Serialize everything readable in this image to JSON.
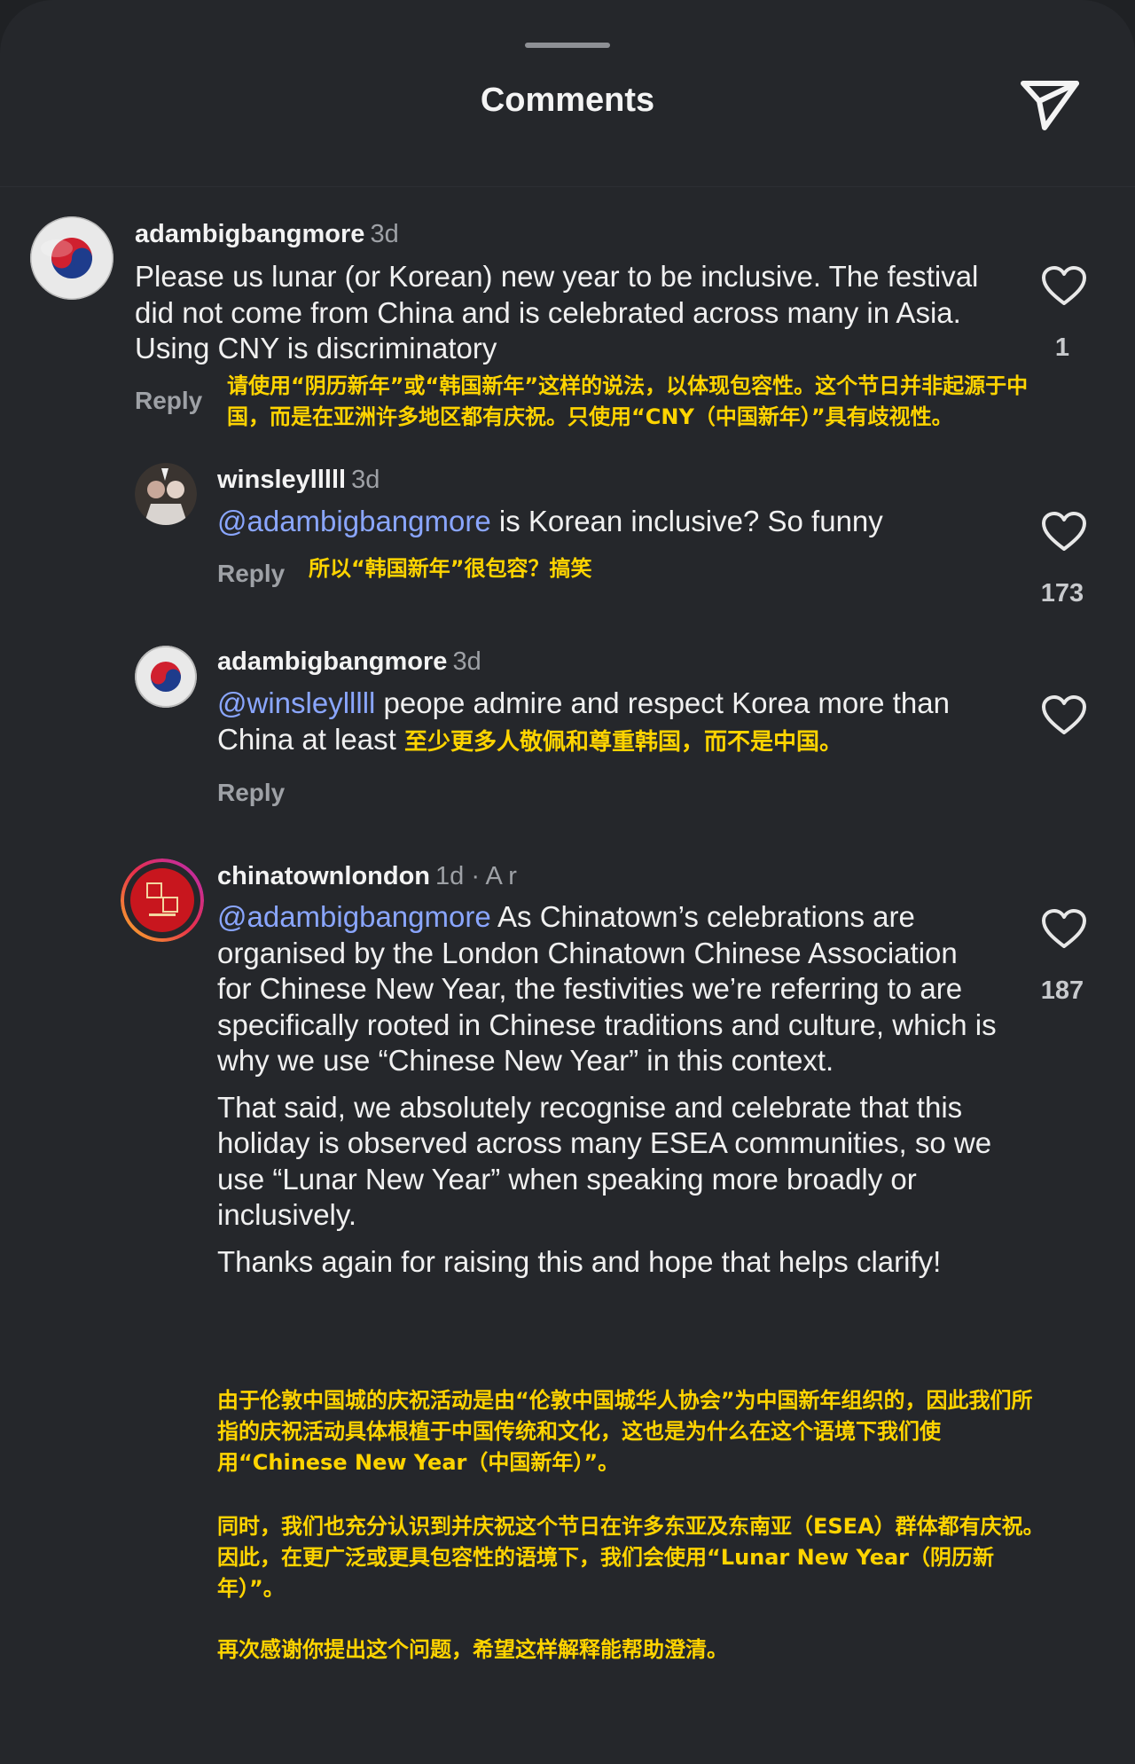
{
  "header": {
    "title": "Comments"
  },
  "comments": [
    {
      "username": "adambigbangmore",
      "time": "3d",
      "text": "Please us lunar (or Korean) new year to be inclusive. The festival did not come from China and is celebrated across many in Asia. Using CNY is discriminatory",
      "reply_label": "Reply",
      "translation": "请使用“阴历新年”或“韩国新年”这样的说法，以体现包容性。这个节日并非起源于中国，而是在亚洲许多地区都有庆祝。只使用“CNY（中国新年）”具有歧视性。",
      "likes": "1"
    },
    {
      "username": "winsleylllll",
      "time": "3d",
      "mention": "@adambigbangmore",
      "text": " is Korean inclusive? So funny",
      "reply_label": "Reply",
      "translation": "所以“韩国新年”很包容？搞笑",
      "likes": "173"
    },
    {
      "username": "adambigbangmore",
      "time": "3d",
      "mention": "@winsleylllll",
      "text": " peope admire and respect Korea more than China at least ",
      "reply_label": "Reply",
      "translation": "至少更多人敬佩和尊重韩国，而不是中国。"
    },
    {
      "username": "chinatownlondon",
      "time": "1d · A    r",
      "mention": "@adambigbangmore",
      "text_p1": " As Chinatown’s celebrations are organised by the London Chinatown Chinese Association for Chinese New Year, the festivities we’re referring to are specifically rooted in Chinese traditions and culture, which is why we use “Chinese New Year” in this context.",
      "text_p2": "That said, we absolutely recognise and celebrate that this holiday is observed across many ESEA communities, so we use “Lunar New Year” when speaking more broadly or inclusively.",
      "text_p3": "Thanks again for raising this and hope that helps clarify!",
      "translation_p1": "由于伦敦中国城的庆祝活动是由“伦敦中国城华人协会”为中国新年组织的，因此我们所指的庆祝活动具体根植于中国传统和文化，这也是为什么在这个语境下我们使用“Chinese New Year（中国新年）”。",
      "translation_p2": "同时，我们也充分认识到并庆祝这个节日在许多东亚及东南亚（ESEA）群体都有庆祝。因此，在更广泛或更具包容性的语境下，我们会使用“Lunar New Year（阴历新年）”。",
      "translation_p3": "再次感谢你提出这个问题，希望这样解释能帮助澄清。",
      "likes": "187"
    }
  ],
  "colors": {
    "background": "#25272b",
    "mention": "#8aa6ff",
    "translation": "#ffd400"
  },
  "icons": {
    "share": "send-icon",
    "like": "heart-icon"
  }
}
